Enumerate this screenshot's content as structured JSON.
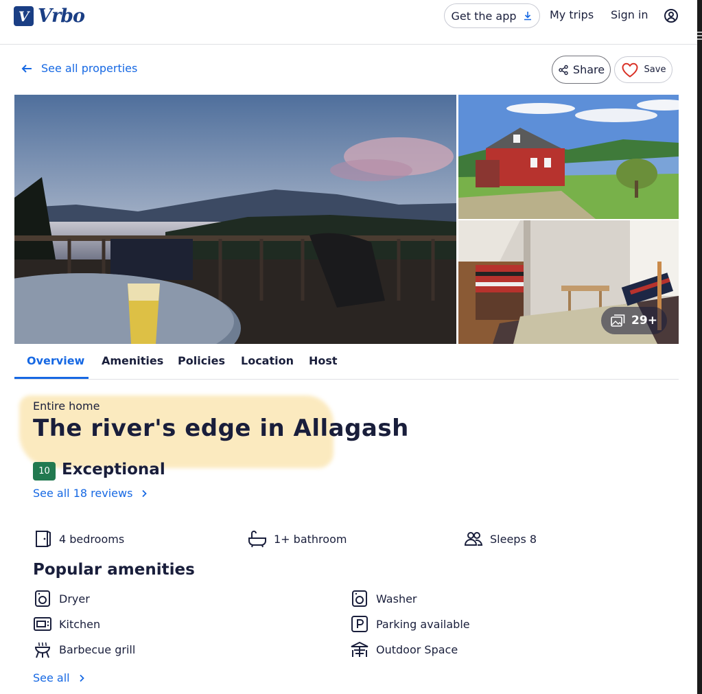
{
  "header": {
    "logo_text": "Vrbo",
    "logo_letter": "V",
    "get_app_label": "Get the app",
    "my_trips_label": "My trips",
    "sign_in_label": "Sign in"
  },
  "subnav": {
    "back_label": "See all properties",
    "share_label": "Share",
    "save_label": "Save"
  },
  "gallery": {
    "photo_count_label": "29+"
  },
  "tabs": [
    "Overview",
    "Amenities",
    "Policies",
    "Location",
    "Host"
  ],
  "active_tab": "Overview",
  "property": {
    "type": "Entire home",
    "title": "The river's edge in Allagash",
    "rating_score": "10",
    "rating_label": "Exceptional",
    "reviews_link": "See all 18 reviews"
  },
  "specs": [
    {
      "icon": "bedroom-icon",
      "label": "4 bedrooms"
    },
    {
      "icon": "bathtub-icon",
      "label": "1+ bathroom"
    },
    {
      "icon": "people-icon",
      "label": "Sleeps 8"
    }
  ],
  "amenities": {
    "title": "Popular amenities",
    "items": [
      {
        "icon": "dryer-icon",
        "label": "Dryer"
      },
      {
        "icon": "washer-icon",
        "label": "Washer"
      },
      {
        "icon": "kitchen-icon",
        "label": "Kitchen"
      },
      {
        "icon": "parking-icon",
        "label": "Parking available"
      },
      {
        "icon": "barbecue-grill-icon",
        "label": "Barbecue grill"
      },
      {
        "icon": "outdoor-space-icon",
        "label": "Outdoor Space"
      }
    ],
    "see_all_label": "See all"
  },
  "colors": {
    "link_blue": "#1668e3",
    "text_dark": "#191e3b",
    "rating_green": "#227950",
    "logo_blue": "#1a3e84",
    "highlight_yellow": "#fbe8b9"
  }
}
